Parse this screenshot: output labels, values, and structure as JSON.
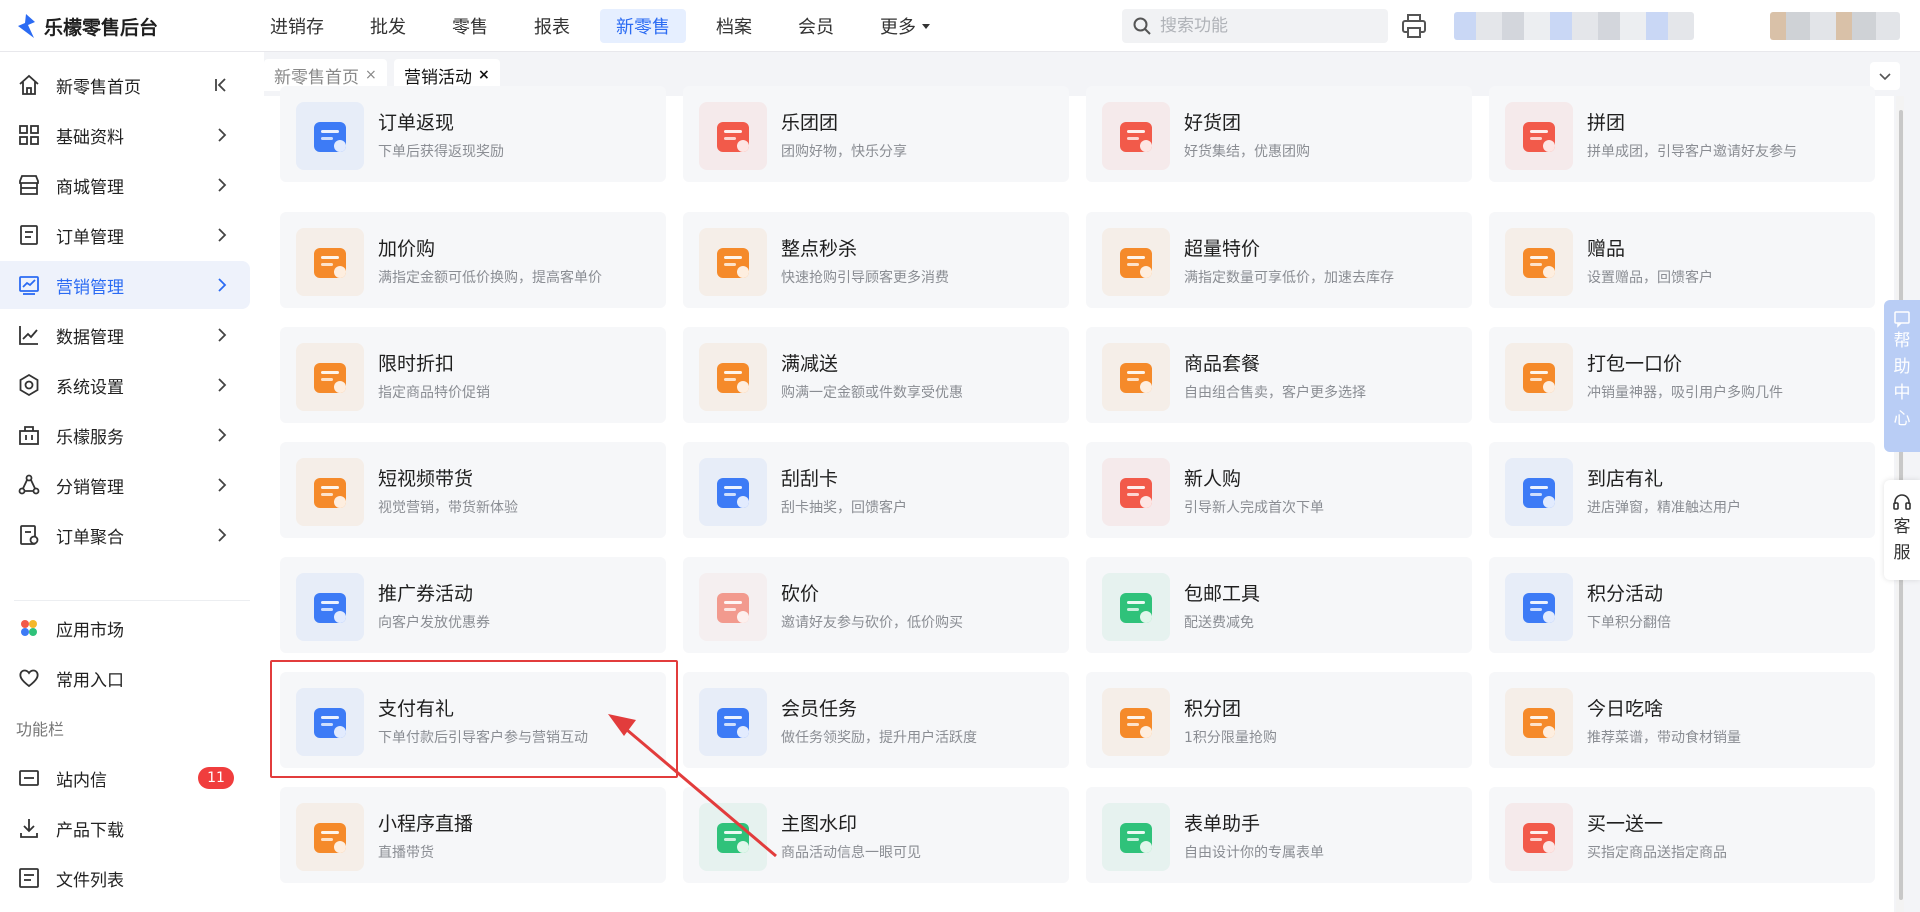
{
  "brand": {
    "name": "乐檬零售后台",
    "color": "#2b6bf3"
  },
  "topnav": {
    "items": [
      "进销存",
      "批发",
      "零售",
      "报表",
      "新零售",
      "档案",
      "会员",
      "更多"
    ],
    "active": "新零售"
  },
  "search": {
    "placeholder": "搜索功能"
  },
  "sidebar": {
    "items": [
      {
        "label": "新零售首页",
        "icon": "home-icon"
      },
      {
        "label": "基础资料",
        "icon": "grid-icon"
      },
      {
        "label": "商城管理",
        "icon": "store-icon"
      },
      {
        "label": "订单管理",
        "icon": "order-icon"
      },
      {
        "label": "营销管理",
        "icon": "marketing-icon"
      },
      {
        "label": "数据管理",
        "icon": "chart-icon"
      },
      {
        "label": "系统设置",
        "icon": "settings-icon"
      },
      {
        "label": "乐檬服务",
        "icon": "building-icon"
      },
      {
        "label": "分销管理",
        "icon": "distribution-icon"
      },
      {
        "label": "订单聚合",
        "icon": "aggregate-icon"
      }
    ],
    "active": "营销管理",
    "extra": [
      {
        "label": "应用市场",
        "icon": "app-market-icon"
      },
      {
        "label": "常用入口",
        "icon": "heart-icon"
      }
    ],
    "section_title": "功能栏",
    "tools": [
      {
        "label": "站内信",
        "icon": "mail-icon",
        "badge": "11"
      },
      {
        "label": "产品下载",
        "icon": "download-icon"
      },
      {
        "label": "文件列表",
        "icon": "file-list-icon"
      }
    ]
  },
  "tabs": [
    {
      "label": "新零售首页",
      "close": "×"
    },
    {
      "label": "营销活动",
      "close": "×"
    }
  ],
  "active_tab": "营销活动",
  "cards": [
    {
      "title": "订单返现",
      "sub": "下单后获得返现奖励",
      "icon": "order-cashback-icon",
      "color": "#3d7bf6"
    },
    {
      "title": "乐团团",
      "sub": "团购好物，快乐分享",
      "icon": "group-buy-icon",
      "color": "#f25a4a"
    },
    {
      "title": "好货团",
      "sub": "好货集结，优惠团购",
      "icon": "shopping-bag-icon",
      "color": "#f25a4a"
    },
    {
      "title": "拼团",
      "sub": "拼单成团，引导客户邀请好友参与",
      "icon": "group-bag-icon",
      "color": "#f25a4a"
    },
    {
      "title": "加价购",
      "sub": "满指定金额可低价换购，提高客单价",
      "icon": "add-price-icon",
      "color": "#f58a2a"
    },
    {
      "title": "整点秒杀",
      "sub": "快速抢购引导顾客更多消费",
      "icon": "alarm-flash-icon",
      "color": "#f58a2a"
    },
    {
      "title": "超量特价",
      "sub": "满指定数量可享低价，加速去库存",
      "icon": "price-tag-icon",
      "color": "#f58a2a"
    },
    {
      "title": "赠品",
      "sub": "设置赠品，回馈客户",
      "icon": "gift-icon",
      "color": "#f58a2a"
    },
    {
      "title": "限时折扣",
      "sub": "指定商品特价促销",
      "icon": "alarm-clock-icon",
      "color": "#f58a2a"
    },
    {
      "title": "满减送",
      "sub": "购满一定金额或件数享受优惠",
      "icon": "red-envelope-icon",
      "color": "#f58a2a"
    },
    {
      "title": "商品套餐",
      "sub": "自由组合售卖，客户更多选择",
      "icon": "package-icon",
      "color": "#f58a2a"
    },
    {
      "title": "打包一口价",
      "sub": "冲销量神器，吸引用户多购几件",
      "icon": "box-icon",
      "color": "#f58a2a"
    },
    {
      "title": "短视频带货",
      "sub": "视觉营销，带货新体验",
      "icon": "video-play-icon",
      "color": "#f58a2a"
    },
    {
      "title": "刮刮卡",
      "sub": "刮卡抽奖，回馈客户",
      "icon": "scratch-card-icon",
      "color": "#3d7bf6"
    },
    {
      "title": "新人购",
      "sub": "引导新人完成首次下单",
      "icon": "new-user-bag-icon",
      "color": "#f25a4a"
    },
    {
      "title": "到店有礼",
      "sub": "进店弹窗，精准触达用户",
      "icon": "storefront-icon",
      "color": "#3d7bf6"
    },
    {
      "title": "推广券活动",
      "sub": "向客户发放优惠券",
      "icon": "coupon-icon",
      "color": "#3d7bf6"
    },
    {
      "title": "砍价",
      "sub": "邀请好友参与砍价，低价购买",
      "icon": "bargain-tag-icon",
      "color": "#f29a8e"
    },
    {
      "title": "包邮工具",
      "sub": "配送费减免",
      "icon": "delivery-truck-icon",
      "color": "#2fc27a"
    },
    {
      "title": "积分活动",
      "sub": "下单积分翻倍",
      "icon": "points-star-icon",
      "color": "#3d7bf6"
    },
    {
      "title": "支付有礼",
      "sub": "下单付款后引导客户参与营销互动",
      "icon": "payment-card-icon",
      "color": "#3d7bf6"
    },
    {
      "title": "会员任务",
      "sub": "做任务领奖励，提升用户活跃度",
      "icon": "task-list-icon",
      "color": "#3d7bf6"
    },
    {
      "title": "积分团",
      "sub": "1积分限量抢购",
      "icon": "coin-stack-icon",
      "color": "#f58a2a"
    },
    {
      "title": "今日吃啥",
      "sub": "推荐菜谱，带动食材销量",
      "icon": "dish-cover-icon",
      "color": "#f58a2a"
    },
    {
      "title": "小程序直播",
      "sub": "直播带货",
      "icon": "live-stream-icon",
      "color": "#f58a2a"
    },
    {
      "title": "主图水印",
      "sub": "商品活动信息一眼可见",
      "icon": "stamp-icon",
      "color": "#2fc27a"
    },
    {
      "title": "表单助手",
      "sub": "自由设计你的专属表单",
      "icon": "form-edit-icon",
      "color": "#2fc27a"
    },
    {
      "title": "买一送一",
      "sub": "买指定商品送指定商品",
      "icon": "buy-one-bag-icon",
      "color": "#f25a4a"
    }
  ],
  "help": {
    "label": [
      "帮",
      "助",
      "中",
      "心"
    ]
  },
  "service": {
    "label": [
      "客",
      "服"
    ]
  }
}
